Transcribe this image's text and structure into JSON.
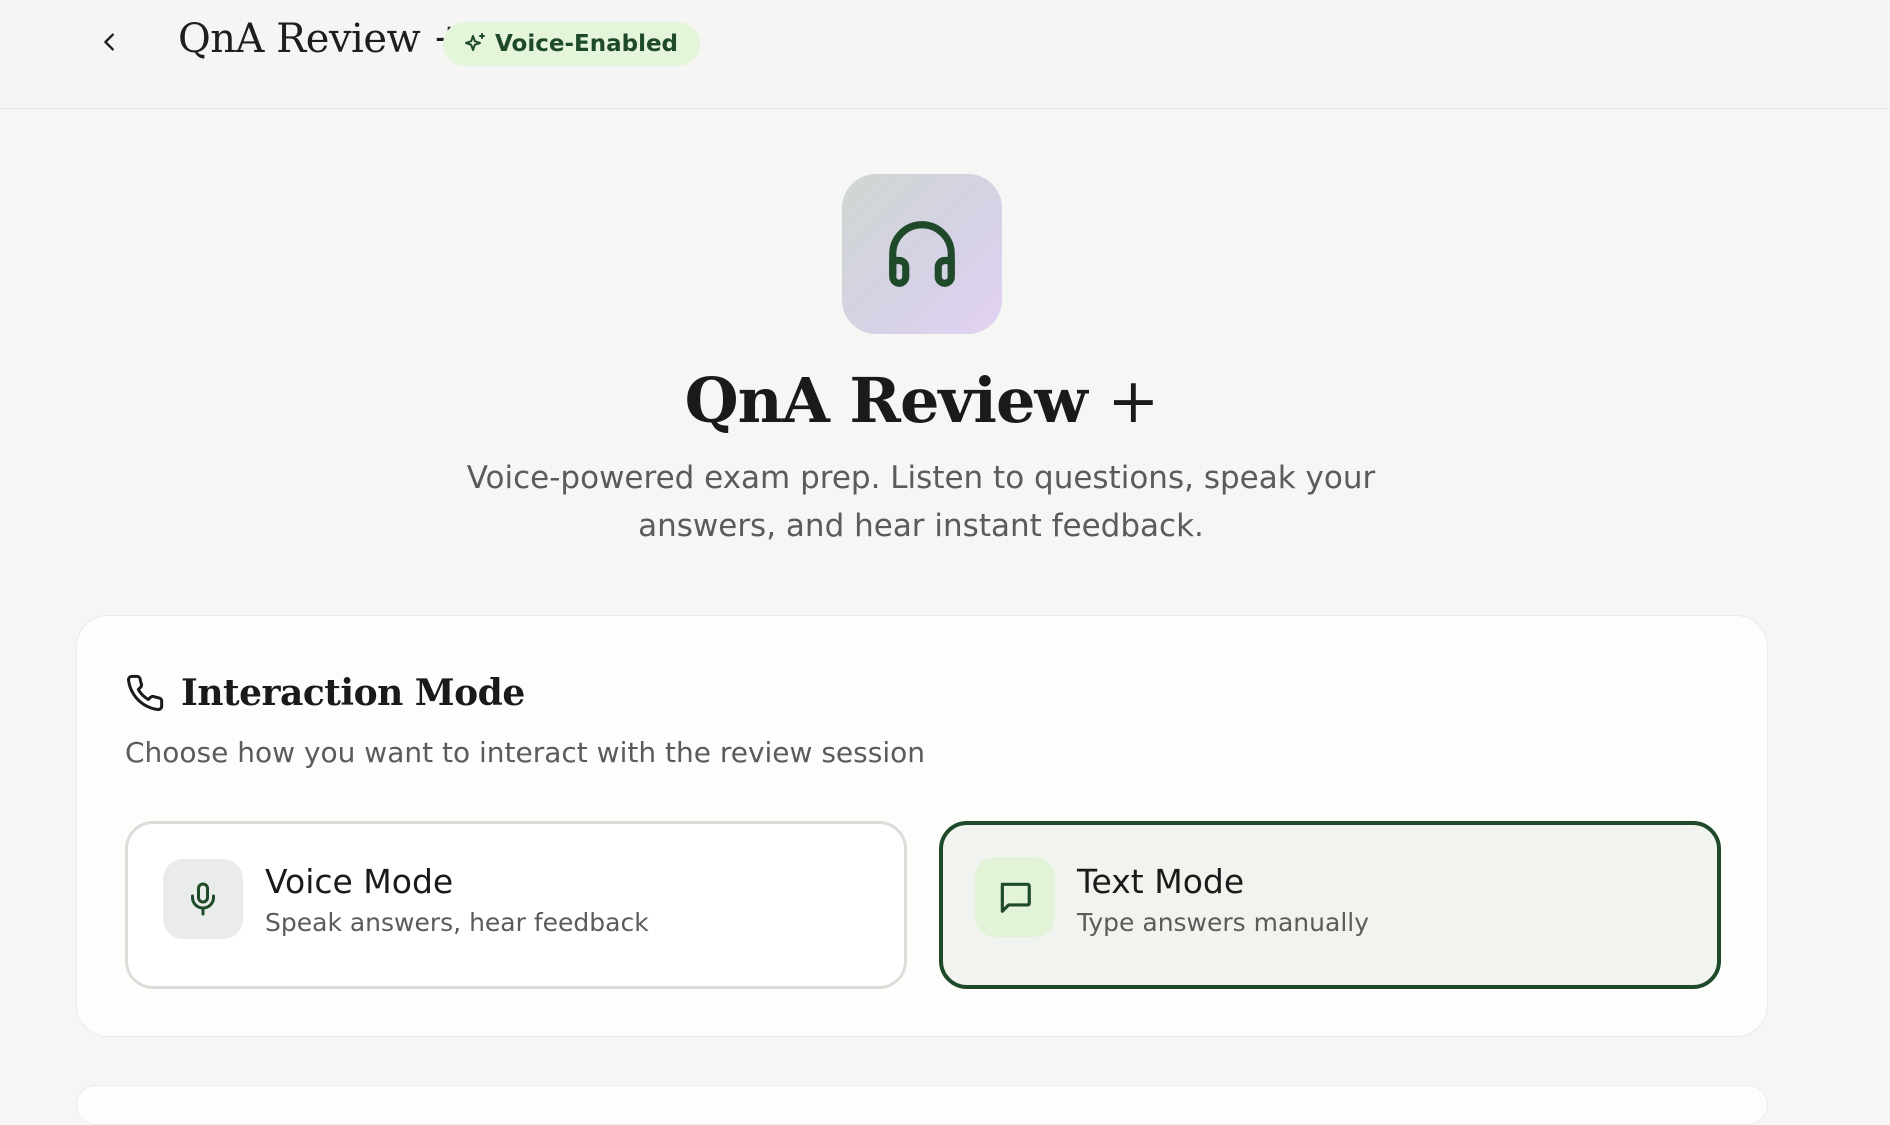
{
  "header": {
    "back_label": "‹",
    "title": "QnA Review +",
    "badge": {
      "label": "Voice-Enabled",
      "icon": "sparkle-icon"
    }
  },
  "hero": {
    "icon": "headphones-icon",
    "title_main": "QnA Review",
    "title_plus": "+",
    "description": "Voice-powered exam prep. Listen to questions, speak your answers, and hear instant feedback."
  },
  "interaction": {
    "icon": "phone-icon",
    "title": "Interaction Mode",
    "subtitle": "Choose how you want to interact with the review session",
    "options": [
      {
        "name": "Voice Mode",
        "description": "Speak answers, hear feedback",
        "icon": "microphone-icon",
        "selected": false
      },
      {
        "name": "Text Mode",
        "description": "Type answers manually",
        "icon": "chat-bubble-icon",
        "selected": true
      }
    ]
  },
  "colors": {
    "accent": "#1f4a2a",
    "badge_bg": "#e4f5da",
    "page_bg": "#f6f6f4"
  }
}
